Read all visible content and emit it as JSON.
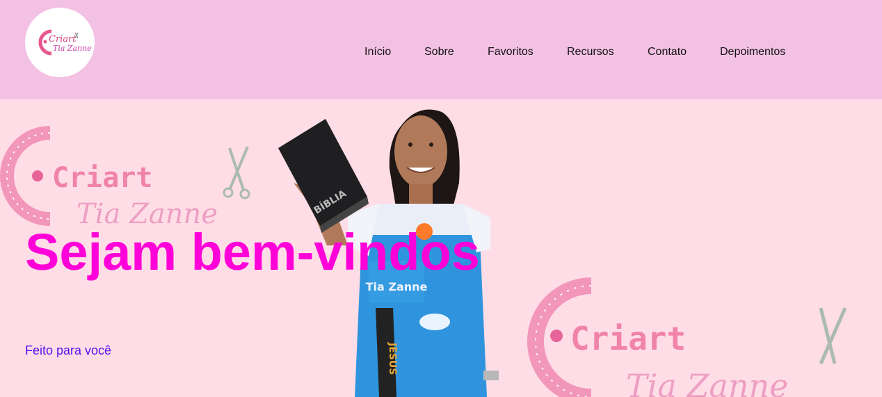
{
  "logo": {
    "icon": "criart-tia-zanne-logo-icon",
    "line1": "Criart",
    "line2": "Tia Zanne"
  },
  "nav": {
    "items": [
      {
        "label": "Início"
      },
      {
        "label": "Sobre"
      },
      {
        "label": "Favoritos"
      },
      {
        "label": "Recursos"
      },
      {
        "label": "Contato"
      },
      {
        "label": "Depoimentos"
      }
    ]
  },
  "hero": {
    "title": "Sejam bem-vindos",
    "subtitle": "Feito para você",
    "background_brand_text": [
      "Criart",
      "Tia Zanne"
    ],
    "background_image": "woman-holding-bible-photo",
    "bible_text": "BÍBLIA",
    "sash_text": "JESUS",
    "dress_text": "Tia Zanne"
  },
  "colors": {
    "header_bg": "#f3c1e3",
    "hero_bg": "#ffdde6",
    "title": "#ff00d8",
    "subtitle": "#5a10f0",
    "nav_text": "#111111"
  }
}
